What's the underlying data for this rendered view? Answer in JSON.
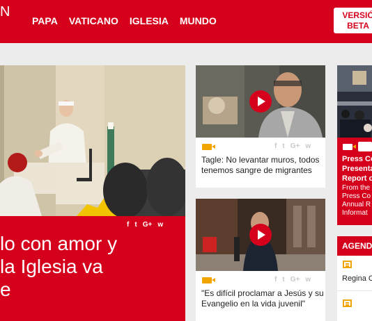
{
  "header": {
    "logo_fragment": "N",
    "nav": [
      "PAPA",
      "VATICANO",
      "IGLESIA",
      "MUNDO"
    ],
    "beta_line1": "VERSIÓ",
    "beta_line2": "BETA"
  },
  "main_story": {
    "title_line1": "lo con amor y",
    "title_line2": "la Iglesia va",
    "title_line3": "e",
    "share": [
      "f",
      "t",
      "G+",
      "w"
    ]
  },
  "card1": {
    "title": "Tagle: No levantar muros, todos tenemos sangre de migrantes",
    "share": [
      "f",
      "t",
      "G+",
      "w"
    ]
  },
  "card2": {
    "title": "\"Es difícil proclamar a Jesús y su Evangelio en la vida juvenil\"",
    "share": [
      "f",
      "t",
      "G+",
      "w"
    ]
  },
  "right_card": {
    "title_line1": "Press Co",
    "title_line2": "Presenta",
    "title_line3": "Report o",
    "body_line1": "From the",
    "body_line2": "Press Co",
    "body_line3": "Annual R",
    "body_line4": "Informat"
  },
  "agenda": {
    "header": "AGEND",
    "item1": "Regina C"
  }
}
